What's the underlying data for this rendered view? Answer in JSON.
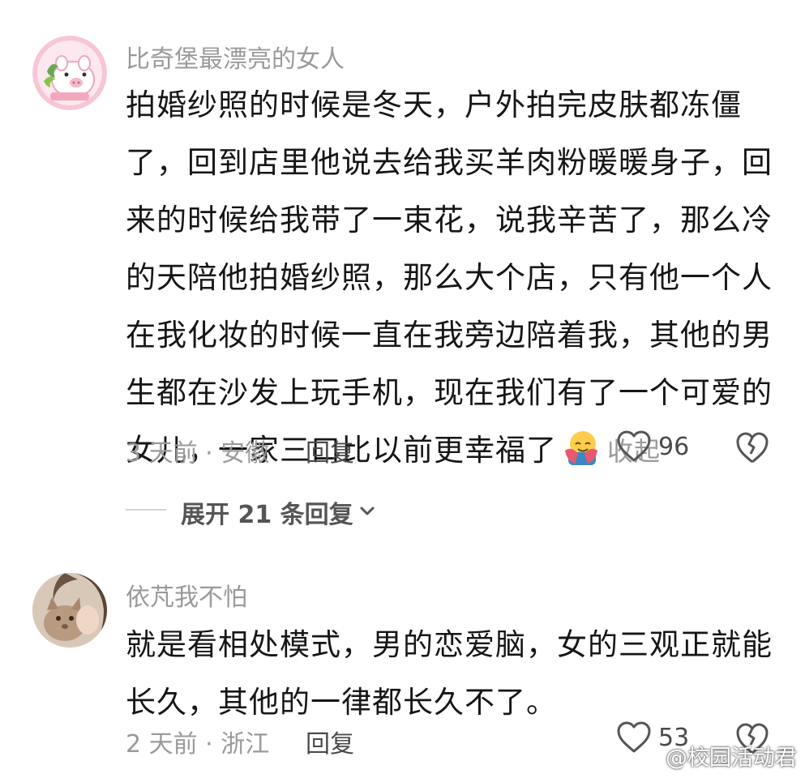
{
  "comments": [
    {
      "username": "比奇堡最漂亮的女人",
      "avatar_icon": "pig-avatar-icon",
      "lines": [
        "拍婚纱照的时候是冬天，户外拍完皮肤都冻僵",
        "了，回到店里他说去给我买羊肉粉暖暖身子，回",
        "来的时候给我带了一束花，说我辛苦了，那么冷",
        "的天陪他拍婚纱照，那么大个店，只有他一个人",
        "在我化妆的时候一直在我旁边陪着我，其他的男",
        "生都在沙发上玩手机，现在我们有了一个可爱的",
        "女儿，一家三口比以前更幸福了"
      ],
      "emoji": "hug-emoji",
      "collapse_label": "收起",
      "meta": "3 天前 · 安徽",
      "reply_label": "回复",
      "like_count": "96",
      "expand_label": "展开 21 条回复"
    },
    {
      "username": "依芃我不怕",
      "avatar_icon": "cat-photo-avatar",
      "lines": [
        "就是看相处模式，男的恋爱脑，女的三观正就能",
        "长久，其他的一律都长久不了。"
      ],
      "meta": "2 天前 · 浙江",
      "reply_label": "回复",
      "like_count": "53"
    }
  ],
  "watermark": "@校园活动君",
  "colors": {
    "text_primary": "#161616",
    "text_secondary": "#9a9a9a",
    "icon": "#555555"
  }
}
